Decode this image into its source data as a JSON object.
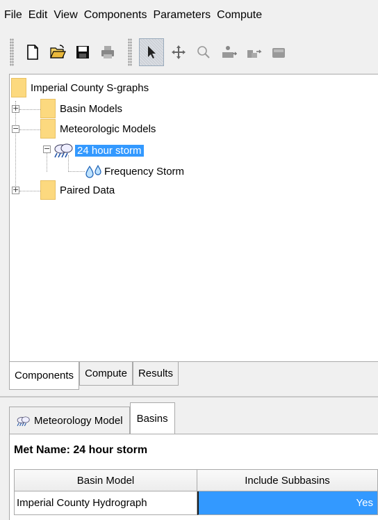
{
  "menu": [
    "File",
    "Edit",
    "View",
    "Components",
    "Parameters",
    "Compute"
  ],
  "toolbar": {
    "buttons": [
      "new-file-icon",
      "open-folder-icon",
      "save-icon",
      "print-icon",
      "select-arrow-icon",
      "pan-icon",
      "zoom-icon",
      "add-element-icon",
      "add-reach-icon",
      "add-sink-icon"
    ]
  },
  "tree": {
    "root": "Imperial County S-graphs",
    "items": [
      {
        "label": "Basin Models",
        "expander": "+"
      },
      {
        "label": "Meteorologic Models",
        "expander": "−"
      },
      {
        "label": "24 hour storm",
        "expander": "−",
        "selected": true
      },
      {
        "label": "Frequency Storm"
      },
      {
        "label": "Paired Data",
        "expander": "+"
      }
    ]
  },
  "component_tabs": [
    "Components",
    "Compute",
    "Results"
  ],
  "editor": {
    "tabs": [
      "Meteorology Model",
      "Basins"
    ],
    "met_name_label": "Met Name:",
    "met_name_value": "24 hour storm",
    "table": {
      "headers": [
        "Basin Model",
        "Include Subbasins"
      ],
      "rows": [
        [
          "Imperial County Hydrograph",
          "Yes"
        ]
      ]
    }
  },
  "colors": {
    "selection": "#3399ff",
    "folder": "#fcd97f"
  }
}
